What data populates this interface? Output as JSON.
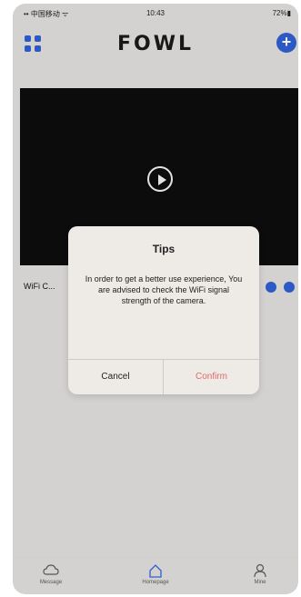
{
  "status": {
    "signal": "•• 中国移动 ᯤ",
    "time": "10:43",
    "battery": "72%▮"
  },
  "app": {
    "logo": "FOWL",
    "add_label": "+"
  },
  "device": {
    "name": "WiFi C..."
  },
  "dialog": {
    "title": "Tips",
    "message": "In order to get a better use experience, You are advised to check the WiFi signal strength of the camera.",
    "cancel": "Cancel",
    "confirm": "Confirm"
  },
  "tabs": [
    {
      "label": "Message",
      "icon": "cloud-icon"
    },
    {
      "label": "Homepage",
      "icon": "home-icon"
    },
    {
      "label": "Mine",
      "icon": "person-icon"
    }
  ],
  "colors": {
    "accent": "#2f5fd0",
    "confirm": "#e06a6a"
  }
}
